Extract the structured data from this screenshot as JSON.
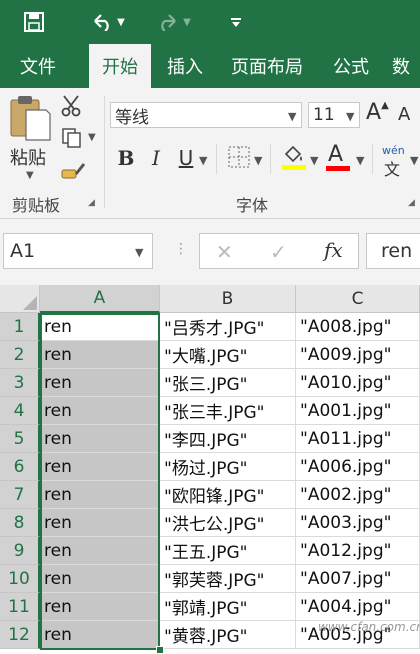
{
  "quick_access": {
    "save_icon": "save-icon",
    "undo_icon": "undo-icon",
    "redo_icon": "redo-icon",
    "customize_icon": "customize-icon"
  },
  "tabs": [
    {
      "label": "文件"
    },
    {
      "label": "开始",
      "active": true
    },
    {
      "label": "插入"
    },
    {
      "label": "页面布局"
    },
    {
      "label": "公式"
    },
    {
      "label": "数"
    }
  ],
  "ribbon": {
    "clipboard": {
      "paste_label": "粘贴",
      "group_label": "剪贴板"
    },
    "font": {
      "font_name": "等线",
      "font_size": "11",
      "bold": "B",
      "italic": "I",
      "underline": "U",
      "font_color_letter": "A",
      "wen_label": "wén",
      "wen_char": "文",
      "group_label": "字体"
    },
    "colors": {
      "accent": "#217346",
      "highlight": "#ffff00",
      "font_color": "#ff0000"
    }
  },
  "formula_bar": {
    "name_box": "A1",
    "fx_label": "fx",
    "formula_value": "ren"
  },
  "sheet": {
    "columns": [
      "A",
      "B",
      "C"
    ],
    "active_cell": "A1",
    "rows": [
      {
        "row": "1",
        "A": "ren",
        "B": "\"吕秀才.JPG\"",
        "C": "\"A008.jpg\""
      },
      {
        "row": "2",
        "A": "ren",
        "B": "\"大嘴.JPG\"",
        "C": "\"A009.jpg\""
      },
      {
        "row": "3",
        "A": "ren",
        "B": "\"张三.JPG\"",
        "C": "\"A010.jpg\""
      },
      {
        "row": "4",
        "A": "ren",
        "B": "\"张三丰.JPG\"",
        "C": "\"A001.jpg\""
      },
      {
        "row": "5",
        "A": "ren",
        "B": "\"李四.JPG\"",
        "C": "\"A011.jpg\""
      },
      {
        "row": "6",
        "A": "ren",
        "B": "\"杨过.JPG\"",
        "C": "\"A006.jpg\""
      },
      {
        "row": "7",
        "A": "ren",
        "B": "\"欧阳锋.JPG\"",
        "C": "\"A002.jpg\""
      },
      {
        "row": "8",
        "A": "ren",
        "B": "\"洪七公.JPG\"",
        "C": "\"A003.jpg\""
      },
      {
        "row": "9",
        "A": "ren",
        "B": "\"王五.JPG\"",
        "C": "\"A012.jpg\""
      },
      {
        "row": "10",
        "A": "ren",
        "B": "\"郭芙蓉.JPG\"",
        "C": "\"A007.jpg\""
      },
      {
        "row": "11",
        "A": "ren",
        "B": "\"郭靖.JPG\"",
        "C": "\"A004.jpg\""
      },
      {
        "row": "12",
        "A": "ren",
        "B": "\"黄蓉.JPG\"",
        "C": "\"A005.jpg\""
      }
    ]
  },
  "watermark": "www.cfan.com.cn"
}
